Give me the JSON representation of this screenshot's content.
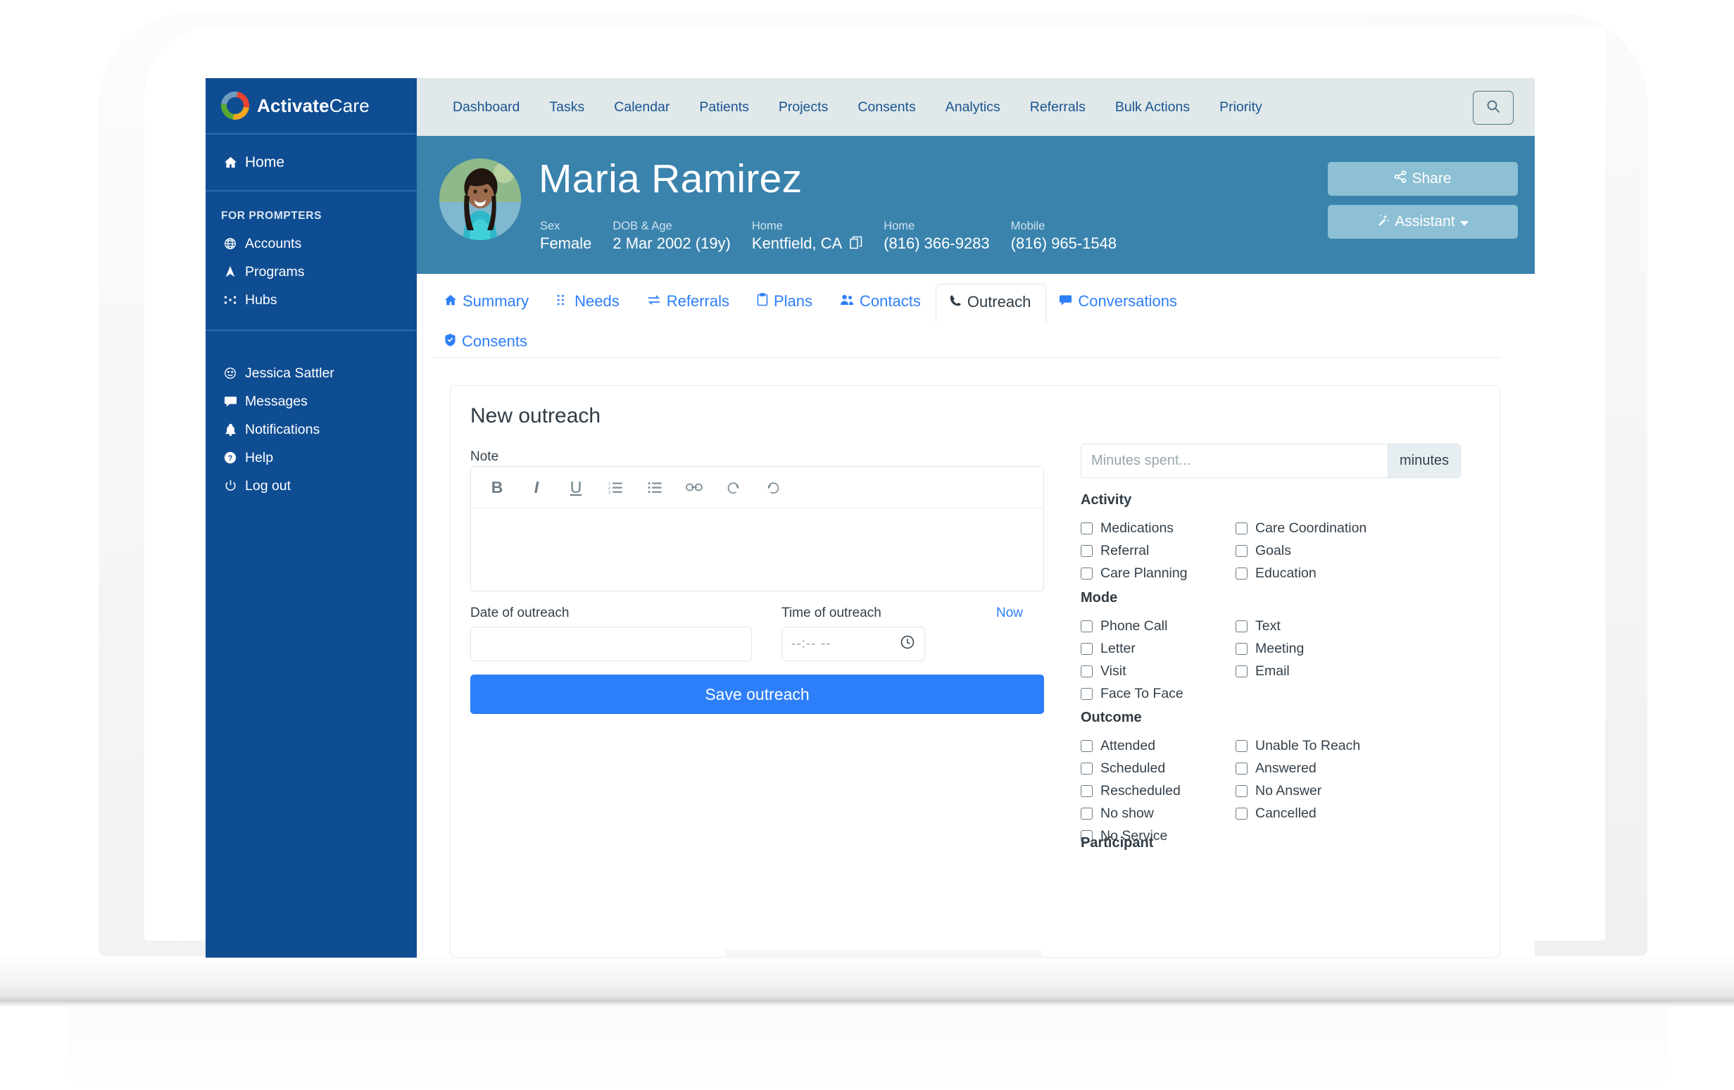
{
  "brand": {
    "bold": "Activate",
    "light": "Care",
    "logo_icon": "activate-care-donut-logo"
  },
  "sidebar": {
    "home": {
      "label": "Home",
      "icon": "home-icon"
    },
    "section_title": "FOR PROMPTERS",
    "items": [
      {
        "label": "Accounts",
        "icon": "globe-icon"
      },
      {
        "label": "Programs",
        "icon": "arrow-up-icon"
      },
      {
        "label": "Hubs",
        "icon": "hubs-icon"
      }
    ],
    "user_items": [
      {
        "label": "Jessica Sattler",
        "icon": "user-circle-icon"
      },
      {
        "label": "Messages",
        "icon": "comment-icon"
      },
      {
        "label": "Notifications",
        "icon": "bell-icon"
      },
      {
        "label": "Help",
        "icon": "question-circle-icon"
      },
      {
        "label": "Log out",
        "icon": "power-icon"
      }
    ]
  },
  "topnav": {
    "items": [
      "Dashboard",
      "Tasks",
      "Calendar",
      "Patients",
      "Projects",
      "Consents",
      "Analytics",
      "Referrals",
      "Bulk Actions",
      "Priority"
    ],
    "search_icon": "search-icon"
  },
  "patient": {
    "name": "Maria Ramirez",
    "avatar_icon": "patient-avatar",
    "meta": [
      {
        "label": "Sex",
        "value": "Female",
        "underlined": false,
        "copyable": false
      },
      {
        "label": "DOB & Age",
        "value": "2 Mar 2002 (19y)",
        "underlined": false,
        "copyable": false
      },
      {
        "label": "Home",
        "value": "Kentfield, CA",
        "underlined": true,
        "copyable": true
      },
      {
        "label": "Home",
        "value": "(816) 366-9283",
        "underlined": false,
        "copyable": false
      },
      {
        "label": "Mobile",
        "value": "(816) 965-1548",
        "underlined": false,
        "copyable": false
      }
    ],
    "share_label": "Share",
    "share_icon": "share-icon",
    "assistant_label": "Assistant",
    "assistant_icon": "magic-wand-icon",
    "assistant_caret": "caret-down-icon"
  },
  "tabs": [
    {
      "label": "Summary",
      "icon": "home-icon",
      "active": false
    },
    {
      "label": "Needs",
      "icon": "needs-icon",
      "active": false
    },
    {
      "label": "Referrals",
      "icon": "exchange-icon",
      "active": false
    },
    {
      "label": "Plans",
      "icon": "clipboard-icon",
      "active": false
    },
    {
      "label": "Contacts",
      "icon": "users-icon",
      "active": false
    },
    {
      "label": "Outreach",
      "icon": "phone-icon",
      "active": true
    },
    {
      "label": "Conversations",
      "icon": "chat-icon",
      "active": false
    },
    {
      "label": "Consents",
      "icon": "shield-check-icon",
      "active": false
    }
  ],
  "outreach": {
    "title": "New outreach",
    "note_label": "Note",
    "note_value": "",
    "toolbar": [
      {
        "label": "B",
        "name": "bold-icon"
      },
      {
        "label": "I",
        "name": "italic-icon"
      },
      {
        "label": "U",
        "name": "underline-icon"
      },
      {
        "label": "",
        "name": "ordered-list-icon"
      },
      {
        "label": "",
        "name": "bullet-list-icon"
      },
      {
        "label": "",
        "name": "link-icon"
      },
      {
        "label": "",
        "name": "undo-icon"
      },
      {
        "label": "",
        "name": "redo-icon"
      }
    ],
    "date_label": "Date of outreach",
    "date_value": "",
    "date_placeholder": "",
    "now_link": "Now",
    "time_label": "Time of outreach",
    "time_placeholder": "--:-- --",
    "time_clock_icon": "clock-icon",
    "save_label": "Save outreach",
    "minutes_placeholder": "Minutes spent...",
    "minutes_value": "",
    "minutes_suffix": "minutes",
    "groups": [
      {
        "title": "Activity",
        "left": [
          "Medications",
          "Referral",
          "Care Planning"
        ],
        "right": [
          "Care Coordination",
          "Goals",
          "Education"
        ]
      },
      {
        "title": "Mode",
        "left": [
          "Phone Call",
          "Letter",
          "Visit",
          "Face To Face"
        ],
        "right": [
          "Text",
          "Meeting",
          "Email"
        ]
      },
      {
        "title": "Outcome",
        "left": [
          "Attended",
          "Scheduled",
          "Rescheduled",
          "No show",
          "No Service"
        ],
        "right": [
          "Unable To Reach",
          "Answered",
          "No Answer",
          "Cancelled"
        ]
      }
    ],
    "participant_title": "Participant"
  },
  "chat_widget": {
    "icon": "chat-bubble-icon"
  },
  "colors": {
    "sidebar": "#0f4d92",
    "topbar": "#e0e8ea",
    "patient_header": "#3a83ad",
    "accent_blue": "#2d7ff9",
    "nav_link": "#1a5490",
    "button_light": "#8dc0d4"
  }
}
